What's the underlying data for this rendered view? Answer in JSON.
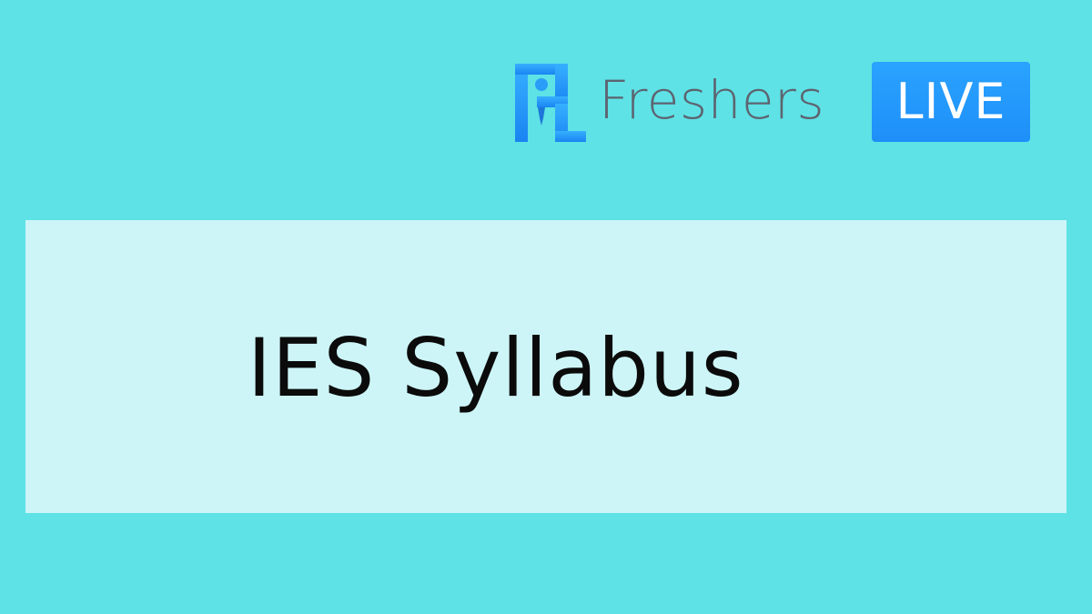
{
  "logo": {
    "brand_text": "Freshers",
    "badge_text": "LIVE",
    "icon": "freshers-live-logo-icon",
    "brand_color": "#5d6470",
    "badge_color": "#2196f3"
  },
  "card": {
    "title": "IES Syllabus"
  },
  "colors": {
    "background": "#5ee2e6",
    "card": "#cdf5f7",
    "title": "#0b0b0b"
  }
}
